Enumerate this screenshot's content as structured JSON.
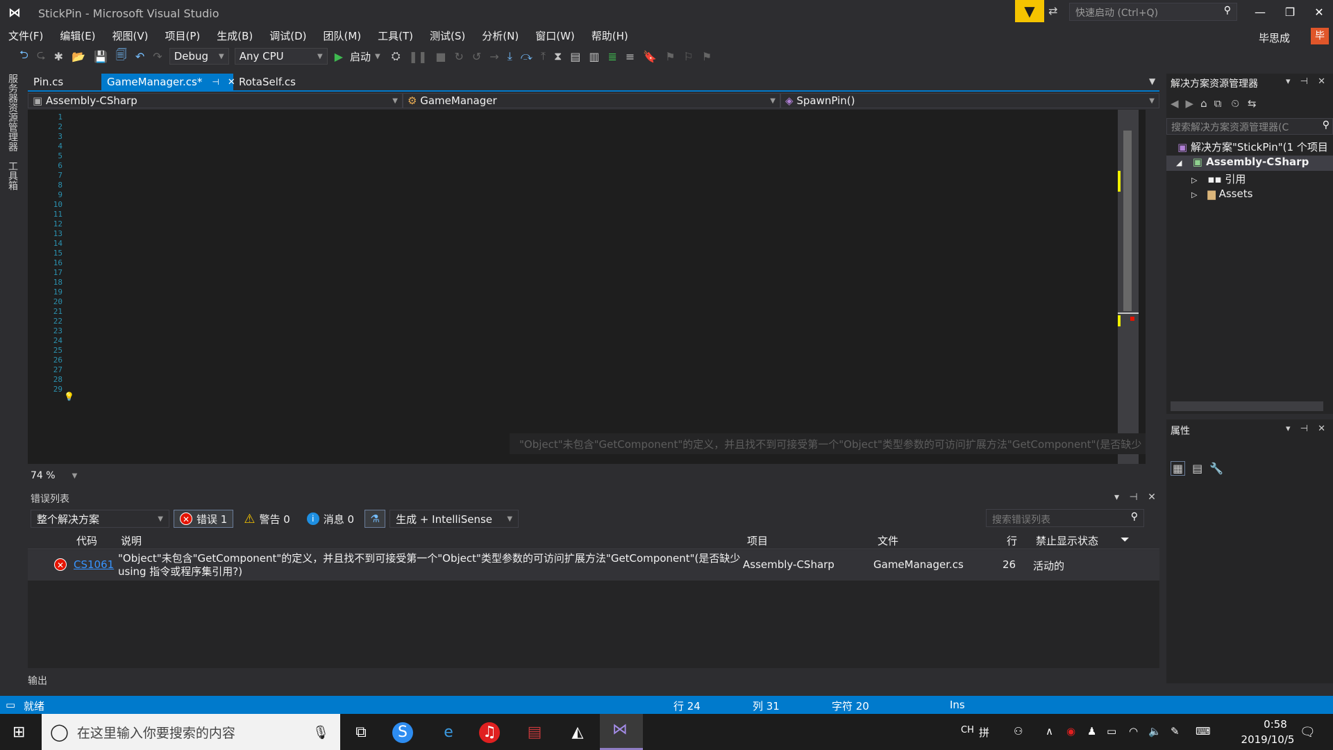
{
  "window": {
    "title": "StickPin - Microsoft Visual Studio",
    "quick_launch_placeholder": "快速启动 (Ctrl+Q)",
    "user": "毕思成",
    "avatar_text": "毕"
  },
  "menu": [
    "文件(F)",
    "编辑(E)",
    "视图(V)",
    "项目(P)",
    "生成(B)",
    "调试(D)",
    "团队(M)",
    "工具(T)",
    "测试(S)",
    "分析(N)",
    "窗口(W)",
    "帮助(H)"
  ],
  "toolbar": {
    "config": "Debug",
    "platform": "Any CPU",
    "start": "启动"
  },
  "side_tabs": [
    "服务器资源管理器",
    "工具箱"
  ],
  "tabs": [
    {
      "label": "Pin.cs"
    },
    {
      "label": "GameManager.cs*",
      "pin": "⊣",
      "close": "✕"
    },
    {
      "label": "RotaSelf.cs"
    }
  ],
  "nav": {
    "project": "Assembly-CSharp",
    "class": "GameManager",
    "member": "SpawnPin()"
  },
  "code_lines": [
    "1",
    "2",
    "3",
    "4",
    "5",
    "6",
    "7",
    "8",
    "9",
    "10",
    "11",
    "12",
    "13",
    "14",
    "15",
    "16",
    "17",
    "18",
    "19",
    "20",
    "21",
    "22",
    "23",
    "24",
    "25",
    "26",
    "27",
    "28",
    "29"
  ],
  "editor": {
    "zoom": "74 %",
    "tooltip": "\"Object\"未包含\"GetComponent\"的定义，并且找不到可接受第一个\"Object\"类型参数的可访问扩展方法\"GetComponent\"(是否缺少 using 指令或程序集引用?)"
  },
  "error_list": {
    "title": "错误列表",
    "scope": "整个解决方案",
    "errors_label": "错误 1",
    "warnings_label": "警告 0",
    "messages_label": "消息 0",
    "build_filter": "生成 + IntelliSense",
    "search_placeholder": "搜索错误列表",
    "columns": {
      "code": "代码",
      "description": "说明",
      "project": "项目",
      "file": "文件",
      "line": "行",
      "suppression": "禁止显示状态"
    },
    "rows": [
      {
        "code": "CS1061",
        "description": "\"Object\"未包含\"GetComponent\"的定义，并且找不到可接受第一个\"Object\"类型参数的可访问扩展方法\"GetComponent\"(是否缺少 using 指令或程序集引用?)",
        "project": "Assembly-CSharp",
        "file": "GameManager.cs",
        "line": "26",
        "suppression": "活动的"
      }
    ]
  },
  "output_label": "输出",
  "solution_explorer": {
    "title": "解决方案资源管理器",
    "search_placeholder": "搜索解决方案资源管理器(C",
    "solution": "解决方案\"StickPin\"(1 个项目",
    "project": "Assembly-CSharp",
    "references": "引用",
    "assets": "Assets"
  },
  "properties": {
    "title": "属性"
  },
  "status": {
    "ready": "就绪",
    "row": "行 24",
    "col": "列 31",
    "char": "字符 20",
    "ins": "Ins"
  },
  "taskbar": {
    "search_placeholder": "在这里输入你要搜索的内容",
    "ime": "CH",
    "time": "0:58",
    "date": "2019/10/5"
  }
}
